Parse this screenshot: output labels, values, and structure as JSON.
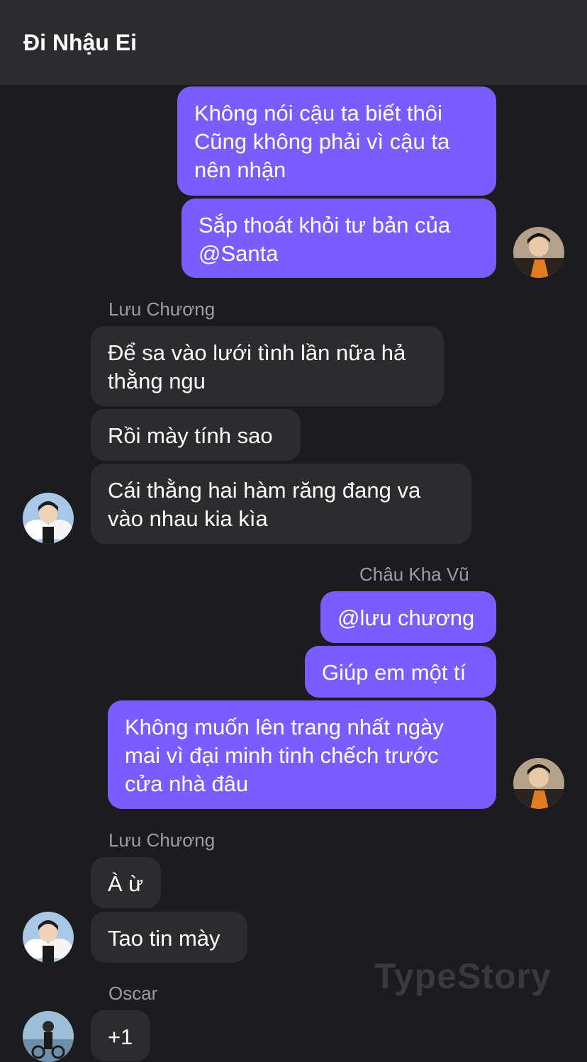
{
  "header": {
    "title": "Đi Nhậu Ei"
  },
  "messages": {
    "m1": {
      "lines": [
        "Không nói cậu ta biết thôi",
        "Cũng không phải vì cậu ta",
        "nên nhận"
      ]
    },
    "m2": {
      "lines": [
        "Sắp thoát khỏi tư bản của",
        "@Santa"
      ]
    },
    "sender1": "Lưu Chương",
    "m3": {
      "lines": [
        "Để sa vào lưới tình lần nữa hả",
        "thằng ngu"
      ]
    },
    "m4": {
      "lines": [
        "Rồi mày tính sao"
      ]
    },
    "m5": {
      "lines": [
        "Cái thằng hai hàm răng đang va",
        "vào nhau kia kìa"
      ]
    },
    "sender2": "Châu Kha Vũ",
    "m6": {
      "lines": [
        "@lưu chương"
      ]
    },
    "m7": {
      "lines": [
        "Giúp em một tí"
      ]
    },
    "m8": {
      "lines": [
        "Không muốn lên trang nhất ngày",
        "mai vì đại minh tinh chếch trước",
        "cửa nhà đâu"
      ]
    },
    "sender3": "Lưu Chương",
    "m9": {
      "lines": [
        "À ừ"
      ]
    },
    "m10": {
      "lines": [
        "Tao tin mày"
      ]
    },
    "sender4": "Oscar",
    "m11": {
      "lines": [
        "+1"
      ]
    }
  },
  "watermark": "TypeStory",
  "colors": {
    "outgoing": "#7b5cff",
    "incoming": "#2c2c2e",
    "background": "#1c1c1e",
    "header": "#2c2c2e"
  }
}
